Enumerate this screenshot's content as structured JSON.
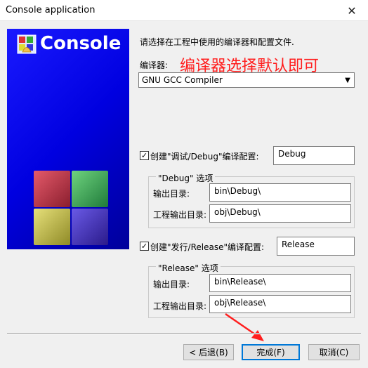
{
  "window": {
    "title": "Console application",
    "close_glyph": "✕"
  },
  "banner": {
    "title": "Console",
    "logo_icon": "codeblocks-logo-icon"
  },
  "intro_text": "请选择在工程中使用的编译器和配置文件.",
  "compiler": {
    "label": "编译器:",
    "value": "GNU GCC Compiler",
    "annotation": "编译器选择默认即可"
  },
  "debug": {
    "checkbox_label": "创建\"调试/Debug\"编译配置:",
    "checked": true,
    "config_name": "Debug",
    "group_title": "\"Debug\" 选项",
    "output_dir_label": "输出目录:",
    "output_dir": "bin\\Debug\\",
    "obj_dir_label": "工程输出目录:",
    "obj_dir": "obj\\Debug\\"
  },
  "release": {
    "checkbox_label": "创建\"发行/Release\"编译配置:",
    "checked": true,
    "config_name": "Release",
    "group_title": "\"Release\" 选项",
    "output_dir_label": "输出目录:",
    "output_dir": "bin\\Release\\",
    "obj_dir_label": "工程输出目录:",
    "obj_dir": "obj\\Release\\"
  },
  "buttons": {
    "back": "< 后退(B)",
    "finish": "完成(F)",
    "cancel": "取消(C)"
  },
  "colors": {
    "annotation": "#ff1e1e",
    "default_button_border": "#0078d7",
    "banner": "#0000e0"
  }
}
